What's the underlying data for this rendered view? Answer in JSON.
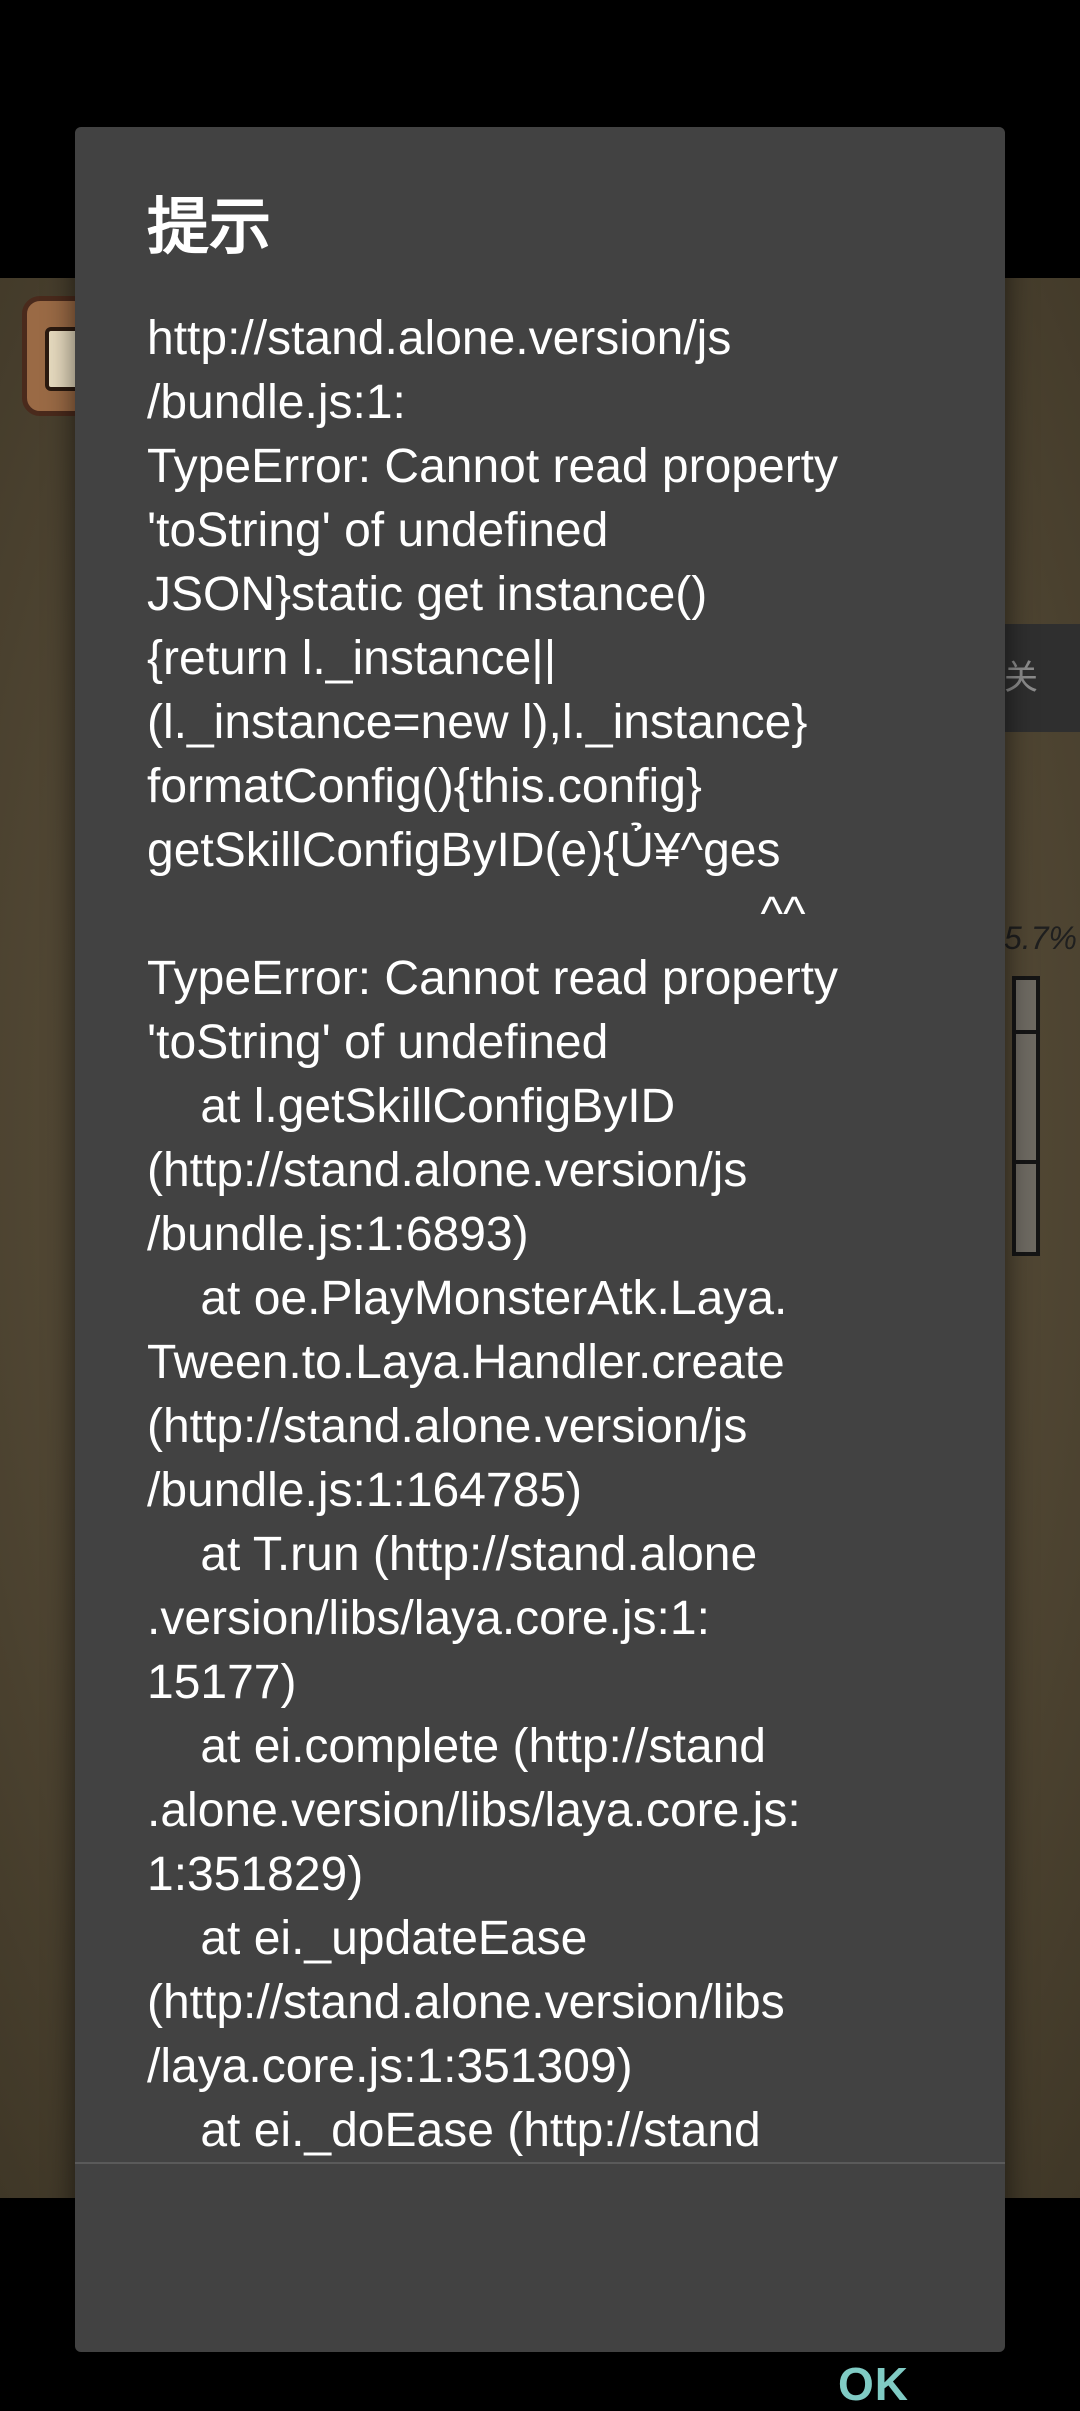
{
  "background": {
    "side_tab_label": "关",
    "side_percent": "5.7%"
  },
  "dialog": {
    "title": "提示",
    "message": "http://stand.alone.version/js\n/bundle.js:1:\nTypeError: Cannot read property\n'toString' of undefined\nJSON}static get instance()\n{return l._instance||\n(l._instance=new l),l._instance}\nformatConfig(){this.config}\ngetSkillConfigByID(e){Ủ¥^ges\n                                              ^^\nTypeError: Cannot read property\n'toString' of undefined\n    at l.getSkillConfigByID\n(http://stand.alone.version/js\n/bundle.js:1:6893)\n    at oe.PlayMonsterAtk.Laya.\nTween.to.Laya.Handler.create\n(http://stand.alone.version/js\n/bundle.js:1:164785)\n    at T.run (http://stand.alone\n.version/libs/laya.core.js:1:\n15177)\n    at ei.complete (http://stand\n.alone.version/libs/laya.core.js:\n1:351829)\n    at ei._updateEase\n(http://stand.alone.version/libs\n/laya.core.js:1:351309)\n    at ei._doEase (http://stand",
    "ok_label": "OK"
  },
  "colors": {
    "dialog_bg": "#424242",
    "accent": "#80cbc4",
    "text": "#ffffff"
  }
}
